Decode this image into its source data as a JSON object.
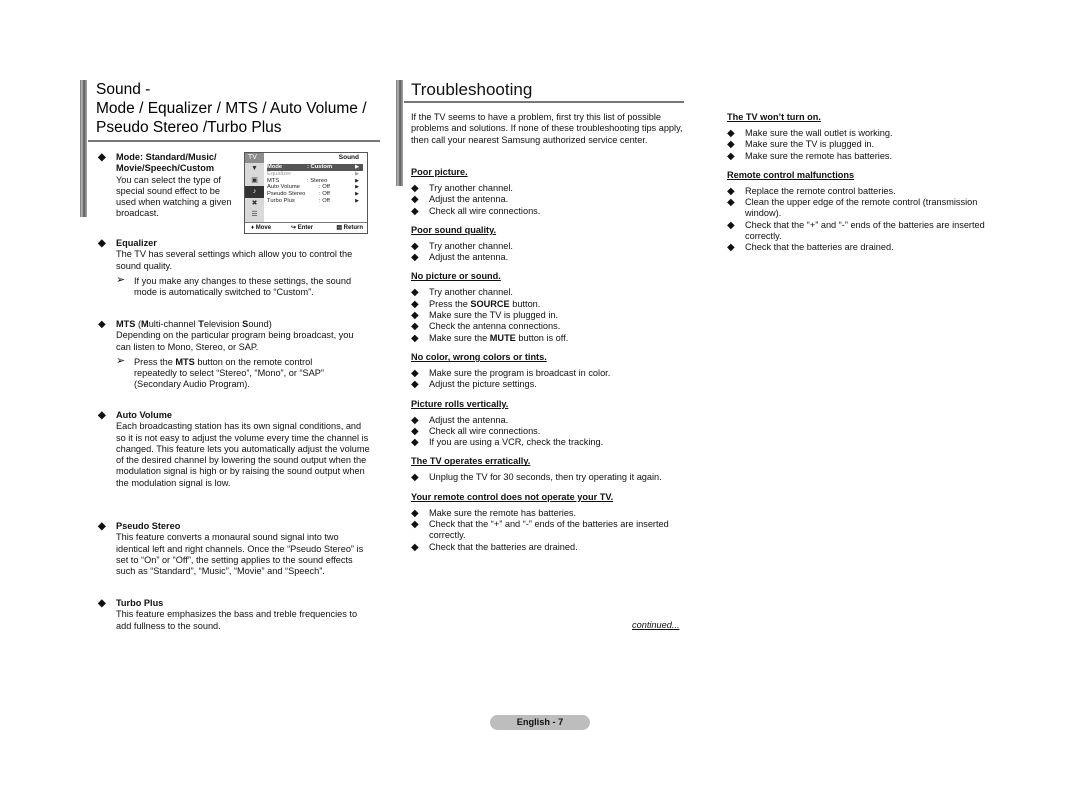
{
  "left": {
    "title_lines": [
      "Sound -",
      "Mode / Equalizer / MTS / Auto Volume /",
      "Pseudo Stereo /Turbo Plus"
    ],
    "sections": {
      "mode": {
        "heading_line1": "Mode: Standard/Music/",
        "heading_line2": "Movie/Speech/Custom",
        "body": [
          "You can select the type of",
          "special sound effect to be",
          "used when watching a given",
          "broadcast."
        ]
      },
      "equalizer": {
        "heading": "Equalizer",
        "body": "The TV has several settings which allow you to control the sound quality.",
        "note": "If you make any changes to these settings, the sound mode is automatically switched to “Custom”."
      },
      "mts": {
        "heading_bold1": "MTS",
        "heading_rest1": " (",
        "heading_bold2": "M",
        "heading_rest2": "ulti-channel ",
        "heading_bold3": "T",
        "heading_rest3": "elevision ",
        "heading_bold4": "S",
        "heading_rest4": "ound)",
        "body": "Depending on the particular program being broadcast, you can listen to Mono, Stereo, or SAP.",
        "note_pre": "Press the ",
        "note_bold": "MTS",
        "note_post": " button on the remote control repeatedly to select “Stereo”, “Mono”, or “SAP” (Secondary Audio Program)."
      },
      "auto_volume": {
        "heading": "Auto Volume",
        "body": "Each broadcasting station has its own signal conditions, and so it is not easy to adjust the volume every time the channel is changed. This feature lets you automatically adjust the volume of the desired channel by lowering the sound output when the modulation signal is high or by raising the sound output when the modulation signal is low."
      },
      "pseudo_stereo": {
        "heading": "Pseudo Stereo",
        "body": "This feature converts a monaural sound signal into two identical left and right channels. Once the “Pseudo Stereo” is set to “On” or “Off”, the setting applies to the sound effects such as “Standard”, “Music”, “Movie” and “Speech”."
      },
      "turbo_plus": {
        "heading": "Turbo Plus",
        "body": "This feature emphasizes the bass and treble frequencies to add fullness to the sound."
      }
    },
    "tv_menu": {
      "tv_label": "TV",
      "header": "Sound",
      "rows": [
        {
          "label": "Mode",
          "value": ": Custom"
        },
        {
          "label": "Equalizer",
          "value": ""
        },
        {
          "label": "MTS",
          "value": ": Stereo"
        },
        {
          "label": "Auto Volume",
          "value": ": Off"
        },
        {
          "label": "Pseudo Stereo",
          "value": ": Off"
        },
        {
          "label": "Turbo Plus",
          "value": ": Off"
        }
      ],
      "arrow": "▶",
      "footer": {
        "move": "Move",
        "enter": "Enter",
        "return": "Return"
      }
    }
  },
  "right": {
    "title": "Troubleshooting",
    "intro": "If the TV seems to have a problem, first try this list of possible problems and solutions. If none of these troubleshooting tips apply, then call your nearest Samsung authorized service center.",
    "groups": [
      {
        "heading": "Poor picture.",
        "items": [
          "Try another channel.",
          "Adjust the antenna.",
          "Check all wire connections."
        ]
      },
      {
        "heading": "Poor sound quality.",
        "items": [
          "Try another channel.",
          "Adjust the antenna."
        ]
      },
      {
        "heading": "No picture or sound.",
        "items": [
          "Try another channel.",
          "Press the SOURCE button.",
          "Make sure the TV is plugged in.",
          "Check the antenna connections.",
          "Make sure the MUTE button is off."
        ]
      },
      {
        "heading": "No color, wrong colors or tints.",
        "items": [
          "Make sure the program is broadcast in color.",
          "Adjust the picture settings."
        ]
      },
      {
        "heading": "Picture rolls vertically.",
        "items": [
          "Adjust the antenna.",
          "Check all wire connections.",
          "If you are using a VCR, check the tracking."
        ]
      },
      {
        "heading": "The TV operates erratically.",
        "items": [
          "Unplug the TV for 30 seconds, then try operating it again."
        ]
      },
      {
        "heading": "Your remote control does not operate your TV.",
        "items": [
          "Make sure the remote has batteries.",
          "Check that the “+” and “-” ends of the batteries are inserted correctly.",
          "Check that the batteries are drained."
        ]
      }
    ],
    "groups_col3": [
      {
        "heading": "The TV won’t turn on.",
        "items": [
          "Make sure the wall outlet is working.",
          "Make sure the TV is plugged in.",
          "Make sure the remote has batteries."
        ]
      },
      {
        "heading": "Remote control malfunctions",
        "items": [
          "Replace the remote control batteries.",
          "Clean the upper edge of the remote control (transmission window).",
          "Check that the “+” and “-” ends of the batteries are inserted correctly.",
          "Check that the batteries are drained."
        ]
      }
    ],
    "continued": "continued..."
  },
  "footer": {
    "page_label": "English - 7"
  }
}
